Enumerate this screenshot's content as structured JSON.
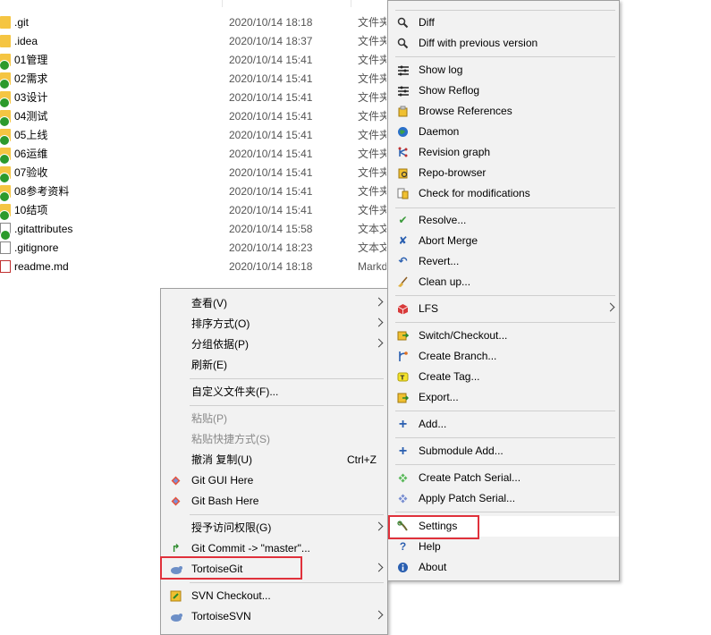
{
  "files": [
    {
      "name": ".git",
      "date": "2020/10/14 18:18",
      "type": "文件夹",
      "kind": "folder",
      "badge": false
    },
    {
      "name": ".idea",
      "date": "2020/10/14 18:37",
      "type": "文件夹",
      "kind": "folder",
      "badge": false
    },
    {
      "name": "01管理",
      "date": "2020/10/14 15:41",
      "type": "文件夹",
      "kind": "folder",
      "badge": true
    },
    {
      "name": "02需求",
      "date": "2020/10/14 15:41",
      "type": "文件夹",
      "kind": "folder",
      "badge": true
    },
    {
      "name": "03设计",
      "date": "2020/10/14 15:41",
      "type": "文件夹",
      "kind": "folder",
      "badge": true
    },
    {
      "name": "04测试",
      "date": "2020/10/14 15:41",
      "type": "文件夹",
      "kind": "folder",
      "badge": true
    },
    {
      "name": "05上线",
      "date": "2020/10/14 15:41",
      "type": "文件夹",
      "kind": "folder",
      "badge": true
    },
    {
      "name": "06运维",
      "date": "2020/10/14 15:41",
      "type": "文件夹",
      "kind": "folder",
      "badge": true
    },
    {
      "name": "07验收",
      "date": "2020/10/14 15:41",
      "type": "文件夹",
      "kind": "folder",
      "badge": true
    },
    {
      "name": "08参考资料",
      "date": "2020/10/14 15:41",
      "type": "文件夹",
      "kind": "folder",
      "badge": true
    },
    {
      "name": "10结项",
      "date": "2020/10/14 15:41",
      "type": "文件夹",
      "kind": "folder",
      "badge": true
    },
    {
      "name": ".gitattributes",
      "date": "2020/10/14 15:58",
      "type": "文本文档",
      "kind": "doc",
      "badge": true
    },
    {
      "name": ".gitignore",
      "date": "2020/10/14 18:23",
      "type": "文本文档",
      "kind": "doc",
      "badge": false
    },
    {
      "name": "readme.md",
      "date": "2020/10/14 18:18",
      "type": "Markdown",
      "kind": "md",
      "badge": false
    }
  ],
  "context_menu": {
    "view": "查看(V)",
    "sort_by": "排序方式(O)",
    "group_by": "分组依据(P)",
    "refresh": "刷新(E)",
    "customize_folder": "自定义文件夹(F)...",
    "paste": "粘贴(P)",
    "paste_shortcut": "粘贴快捷方式(S)",
    "undo_copy": "撤消 复制(U)",
    "undo_copy_shortcut": "Ctrl+Z",
    "git_gui_here": "Git GUI Here",
    "git_bash_here": "Git Bash Here",
    "give_access": "授予访问权限(G)",
    "git_commit": "Git Commit -> \"master\"...",
    "tortoisegit": "TortoiseGit",
    "svn_checkout": "SVN Checkout...",
    "tortoisesvn": "TortoiseSVN"
  },
  "tortoise_menu": {
    "diff": "Diff",
    "diff_prev": "Diff with previous version",
    "show_log": "Show log",
    "show_reflog": "Show Reflog",
    "browse_refs": "Browse References",
    "daemon": "Daemon",
    "revision_graph": "Revision graph",
    "repo_browser": "Repo-browser",
    "check_mods": "Check for modifications",
    "resolve": "Resolve...",
    "abort_merge": "Abort Merge",
    "revert": "Revert...",
    "clean_up": "Clean up...",
    "lfs": "LFS",
    "switch_checkout": "Switch/Checkout...",
    "create_branch": "Create Branch...",
    "create_tag": "Create Tag...",
    "export": "Export...",
    "add": "Add...",
    "submodule_add": "Submodule Add...",
    "create_patch": "Create Patch Serial...",
    "apply_patch": "Apply Patch Serial...",
    "settings": "Settings",
    "help": "Help",
    "about": "About"
  },
  "colors": {
    "highlight_box": "#e0313b",
    "menu_bg": "#f2f2f2",
    "folder": "#f5c542",
    "badge": "#2c9a2c"
  }
}
